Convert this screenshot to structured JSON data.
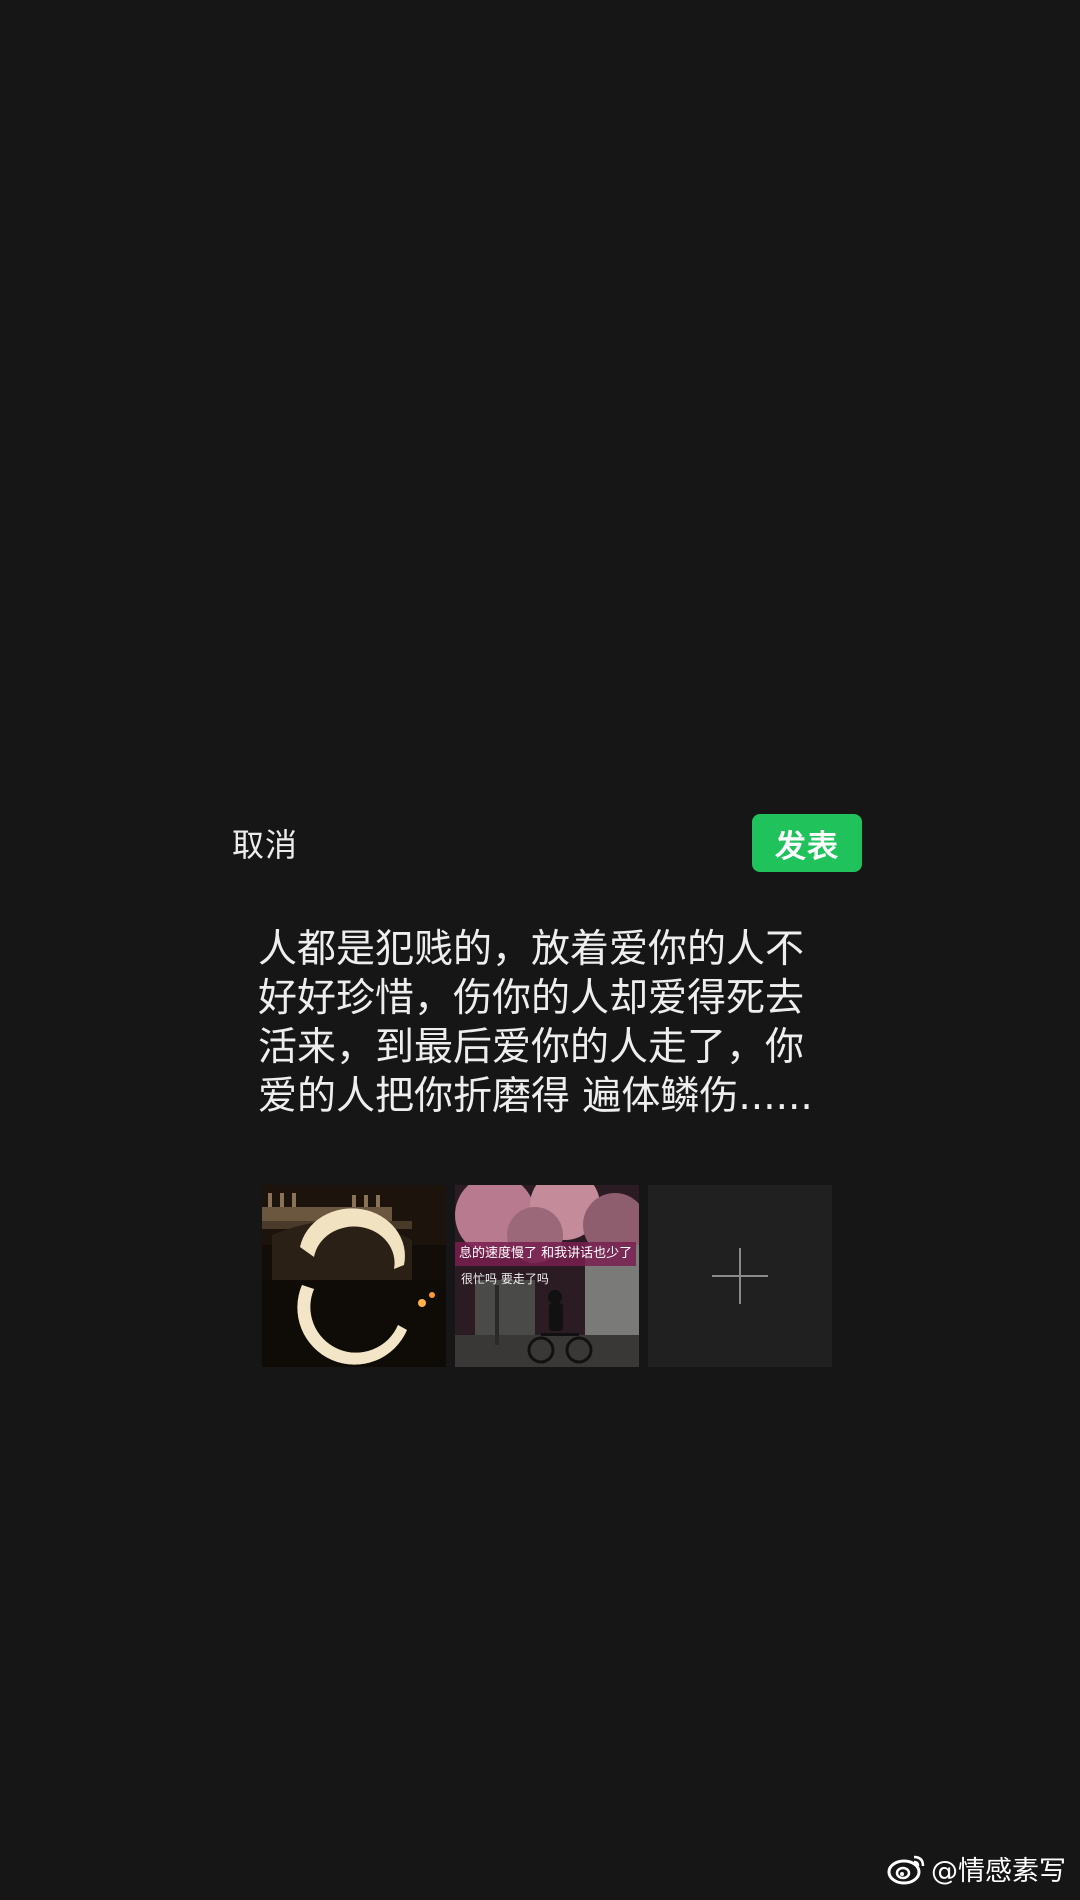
{
  "header": {
    "cancel_label": "取消",
    "publish_label": "发表"
  },
  "post": {
    "text": "人都是犯贱的，放着爱你的人不好好珍惜，伤你的人却爱得死去活来，到最后爱你的人走了，你爱的人把你折磨得 遍体鳞伤......"
  },
  "media": {
    "items": [
      {
        "icon": "bridge-night-photo"
      },
      {
        "icon": "cyclist-photo",
        "caption_line1": "息的速度慢了 和我讲话也少了",
        "caption_line2": "很忙吗  要走了吗"
      }
    ],
    "add_icon": "plus-icon"
  },
  "watermark": {
    "icon": "weibo-icon",
    "text": "@情感素写"
  },
  "colors": {
    "background": "#161616",
    "publish_button": "#1fc25b",
    "text": "#eeeeee"
  }
}
